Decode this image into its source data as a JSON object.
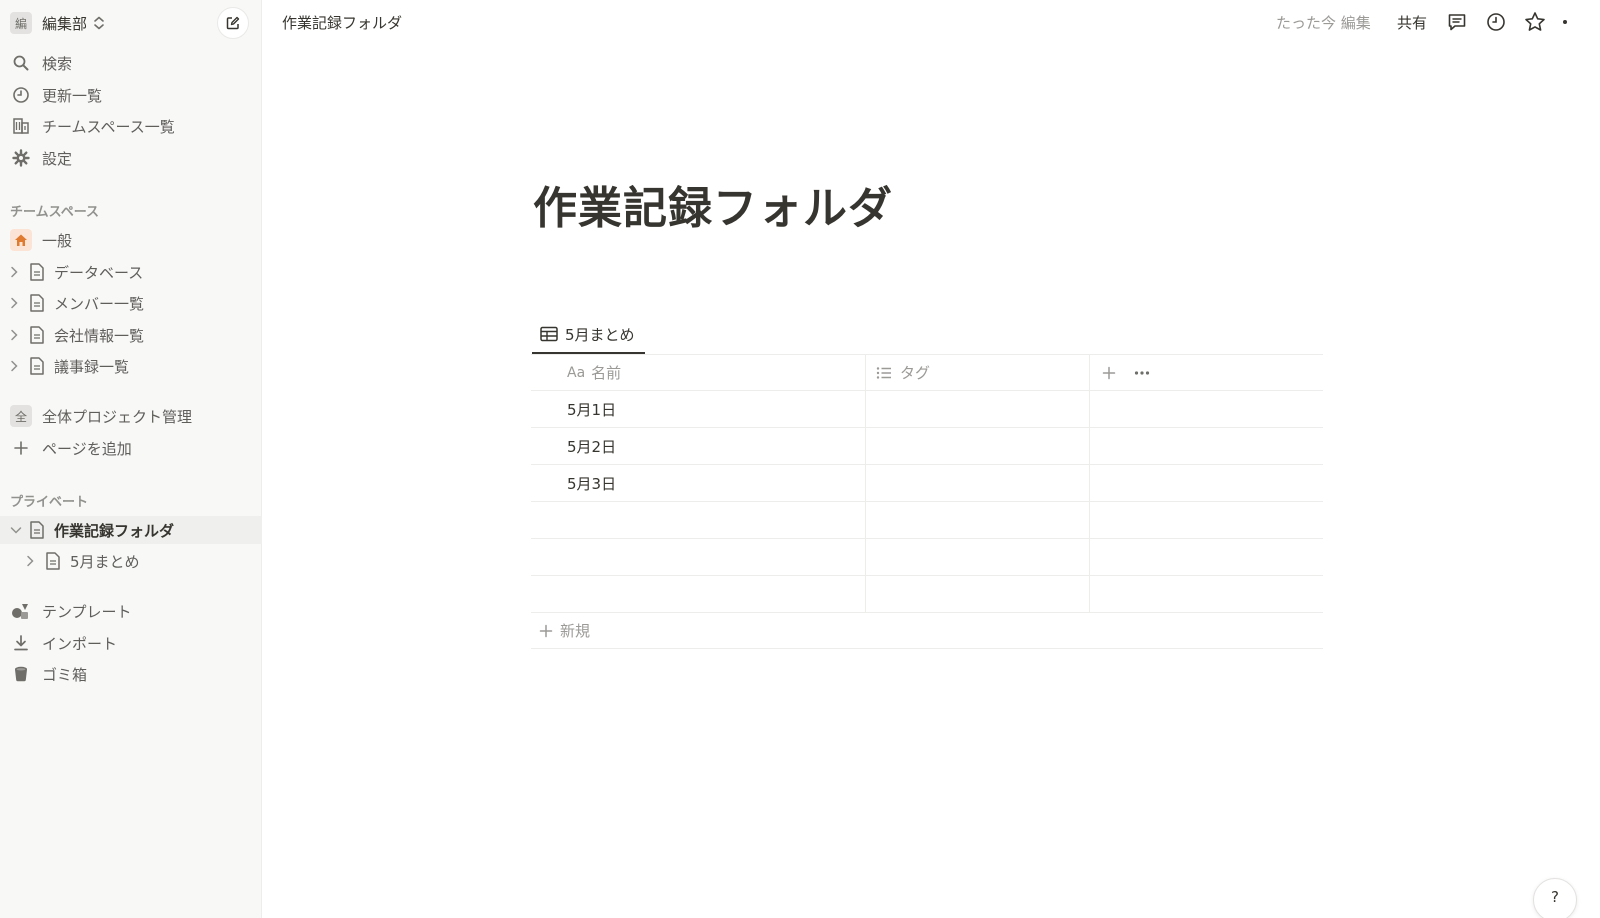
{
  "sidebar": {
    "workspace": {
      "badge": "編",
      "name": "編集部"
    },
    "nav": [
      {
        "label": "検索",
        "icon": "search-icon"
      },
      {
        "label": "更新一覧",
        "icon": "clock-icon"
      },
      {
        "label": "チームスペース一覧",
        "icon": "building-icon"
      },
      {
        "label": "設定",
        "icon": "gear-icon"
      }
    ],
    "teamspace": {
      "title": "チームスペース",
      "home": "一般",
      "pages": [
        "データベース",
        "メンバー一覧",
        "会社情報一覧",
        "議事録一覧"
      ],
      "project_badge": "全",
      "project": "全体プロジェクト管理",
      "add_page": "ページを追加"
    },
    "private": {
      "title": "プライベート",
      "active_page": "作業記録フォルダ",
      "child_page": "5月まとめ"
    },
    "bottom": [
      {
        "label": "テンプレート",
        "icon": "shapes-icon"
      },
      {
        "label": "インポート",
        "icon": "download-icon"
      },
      {
        "label": "ゴミ箱",
        "icon": "trash-icon"
      }
    ]
  },
  "topbar": {
    "breadcrumb": "作業記録フォルダ",
    "edited": "たった今 編集",
    "share": "共有"
  },
  "main": {
    "title": "作業記録フォルダ",
    "view_tab": "5月まとめ",
    "table": {
      "col_name_prefix": "Aa",
      "col_name": "名前",
      "col_tag": "タグ",
      "rows": [
        "5月1日",
        "5月2日",
        "5月3日",
        "",
        "",
        ""
      ],
      "new_label": "新規"
    }
  },
  "help": "?"
}
